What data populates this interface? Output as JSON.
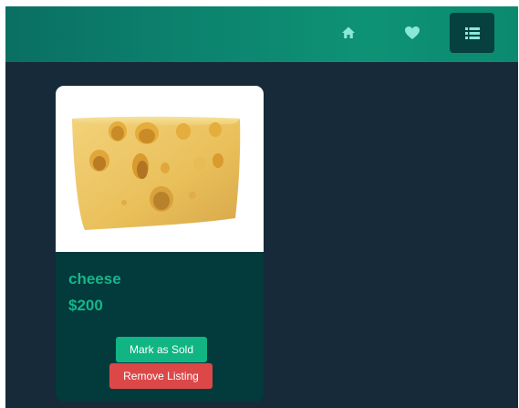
{
  "navbar": {
    "items": [
      {
        "icon": "home-icon",
        "active": false
      },
      {
        "icon": "heart-icon",
        "active": false
      },
      {
        "icon": "list-icon",
        "active": true
      }
    ],
    "icon_color": "#8be8d8",
    "active_background": "#06403f"
  },
  "listing": {
    "image_icon": "cheese-image",
    "title": "cheese",
    "price": "$200",
    "mark_sold_label": "Mark as Sold",
    "remove_label": "Remove Listing"
  },
  "colors": {
    "background": "#172a3a",
    "card": "#033a3c",
    "accent": "#14b68a",
    "sold_button": "#10b583",
    "remove_button": "#dc4848"
  }
}
